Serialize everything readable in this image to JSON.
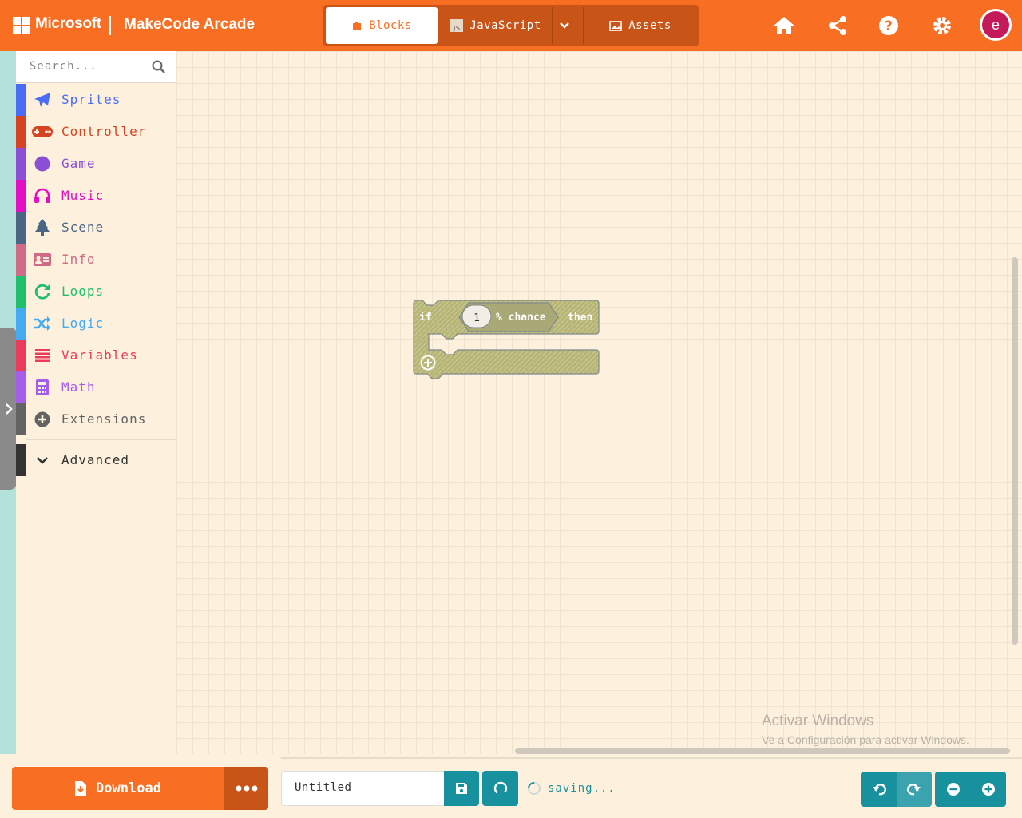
{
  "header": {
    "brand": "Microsoft",
    "app_title": "MakeCode Arcade",
    "tabs": [
      {
        "label": "Blocks",
        "icon": "puzzle-icon",
        "active": true
      },
      {
        "label": "JavaScript",
        "icon": "js-icon",
        "active": false
      },
      {
        "label": "Assets",
        "icon": "image-icon",
        "active": false
      }
    ],
    "icons": [
      "home-icon",
      "share-icon",
      "help-icon",
      "settings-icon"
    ],
    "avatar_letter": "e",
    "accent_color": "#f86e23"
  },
  "toolbox": {
    "search_placeholder": "Search...",
    "categories": [
      {
        "label": "Sprites",
        "icon": "paper-plane-icon",
        "color": "#4b6cf5"
      },
      {
        "label": "Controller",
        "icon": "gamepad-icon",
        "color": "#d54322"
      },
      {
        "label": "Game",
        "icon": "circle-icon",
        "color": "#8b4fd6"
      },
      {
        "label": "Music",
        "icon": "headphones-icon",
        "color": "#e30fc0"
      },
      {
        "label": "Scene",
        "icon": "tree-icon",
        "color": "#4b6584"
      },
      {
        "label": "Info",
        "icon": "id-card-icon",
        "color": "#cf6a87"
      },
      {
        "label": "Loops",
        "icon": "refresh-icon",
        "color": "#20bf6b"
      },
      {
        "label": "Logic",
        "icon": "shuffle-icon",
        "color": "#45aaf2"
      },
      {
        "label": "Variables",
        "icon": "list-icon",
        "color": "#eb3b5a"
      },
      {
        "label": "Math",
        "icon": "calculator-icon",
        "color": "#a55eea"
      },
      {
        "label": "Extensions",
        "icon": "plus-circle-icon",
        "color": "#636363"
      }
    ],
    "advanced": {
      "label": "Advanced",
      "icon": "chevron-down-icon",
      "color": "#333333"
    }
  },
  "workspace": {
    "block": {
      "if_label": "if",
      "value": "1",
      "chance_label": "% chance",
      "then_label": "then"
    },
    "watermark": {
      "title": "Activar Windows",
      "subtitle": "Ve a Configuración para activar Windows."
    }
  },
  "footer": {
    "download_label": "Download",
    "project_name": "Untitled",
    "status": "saving...",
    "controls": [
      "undo-icon",
      "redo-icon",
      "zoom-out-icon",
      "zoom-in-icon"
    ]
  }
}
